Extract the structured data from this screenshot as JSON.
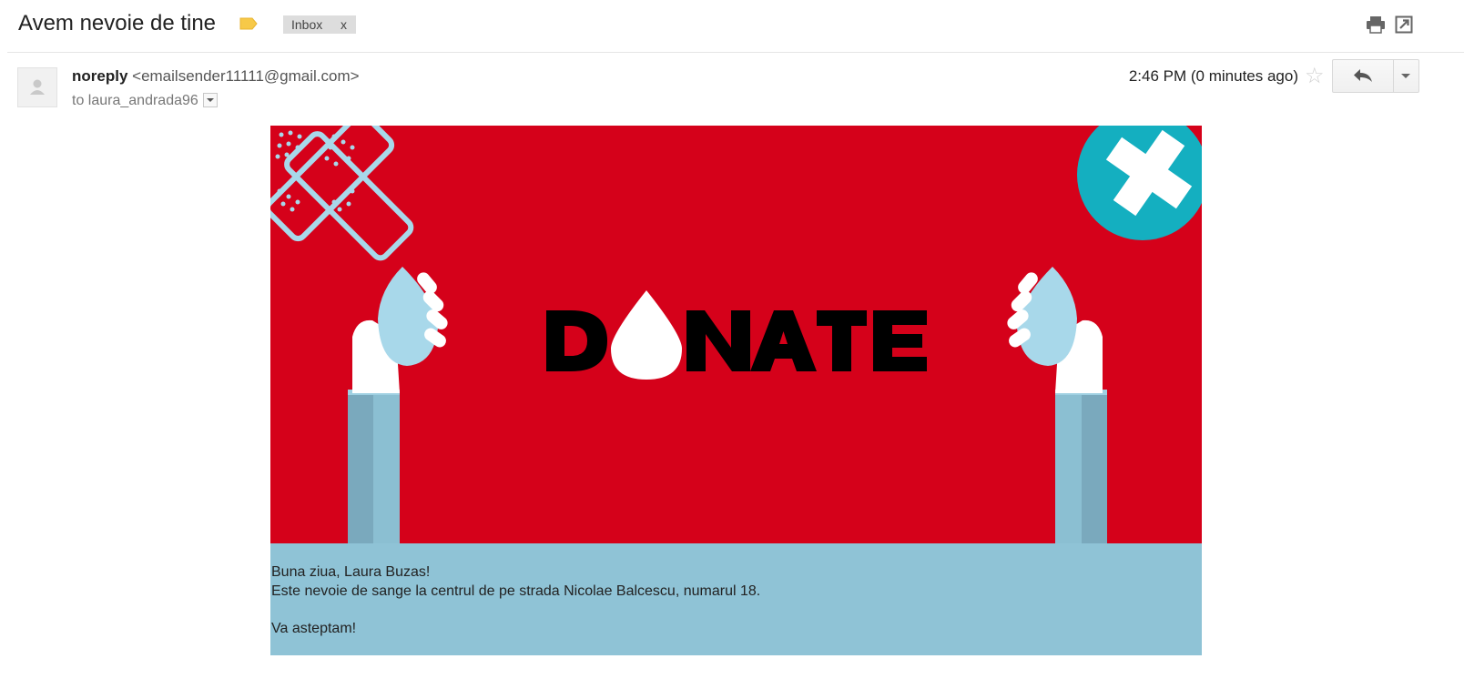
{
  "email": {
    "subject": "Avem nevoie de tine",
    "label_chip": {
      "label": "Inbox",
      "remove": "x"
    },
    "sender": {
      "name": "noreply",
      "email": "<emailsender11111@gmail.com>"
    },
    "to_line": "to laura_andrada96",
    "timestamp": "2:46 PM (0 minutes ago)",
    "banner_word": "D NATE",
    "body": {
      "greeting": "Buna ziua, Laura Buzas!",
      "line2": "Este nevoie de sange la centrul de pe strada Nicolae Balcescu, numarul 18.",
      "closing": "Va asteptam!"
    }
  },
  "icons": {
    "label": "label-tag-icon",
    "print": "printer-icon",
    "popout": "new-window-icon",
    "star": "star-icon",
    "reply": "reply-arrow-icon",
    "more": "chevron-down-icon",
    "avatar": "person-icon"
  },
  "colors": {
    "banner_red": "#d5011a",
    "banner_blue": "#8fc3d6",
    "label_yellow": "#f7c948",
    "cross_teal": "#14afc0"
  }
}
